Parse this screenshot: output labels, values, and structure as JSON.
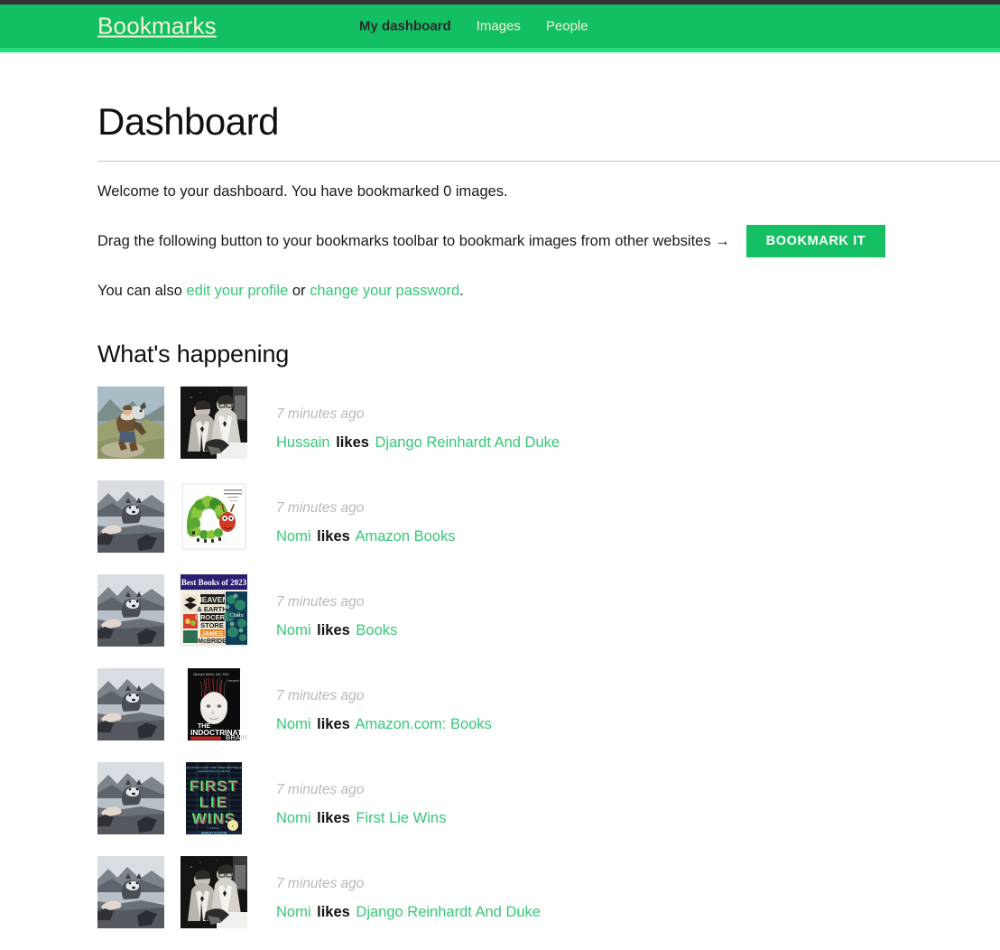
{
  "header": {
    "brand": "Bookmarks",
    "nav": [
      {
        "label": "My dashboard",
        "active": true
      },
      {
        "label": "Images",
        "active": false
      },
      {
        "label": "People",
        "active": false
      }
    ],
    "colors": {
      "top_bar": "#333333",
      "band": "#12bf63",
      "underline": "#27de7d",
      "brand_text": "#f5f0d8",
      "active_nav_text": "#2a2a2a"
    }
  },
  "main": {
    "page_title": "Dashboard",
    "welcome_text": "Welcome to your dashboard. You have bookmarked 0 images.",
    "bookmarked_count": 0,
    "bookmarklet_text": "Drag the following button to your bookmarks toolbar to bookmark images from other websites →",
    "bookmarklet_button_label": "BOOKMARK IT",
    "bookmarklet_button_color": "#15c065",
    "profile_line": {
      "prefix": "You can also ",
      "edit_profile_label": "edit your profile",
      "separator": " or ",
      "change_password_label": "change your password",
      "suffix": "."
    },
    "link_color": "#36c877"
  },
  "happening": {
    "title": "What's happening",
    "items": [
      {
        "time": "7 minutes ago",
        "user": "Hussain",
        "verb": "likes",
        "target": "Django Reinhardt And Duke",
        "thumb_left": "man-with-husky-photo",
        "thumb_right": "django-duke-bw-photo"
      },
      {
        "time": "7 minutes ago",
        "user": "Nomi",
        "verb": "likes",
        "target": "Amazon Books",
        "thumb_left": "wolf-mountain-photo",
        "thumb_right": "very-hungry-caterpillar-cover"
      },
      {
        "time": "7 minutes ago",
        "user": "Nomi",
        "verb": "likes",
        "target": "Books",
        "thumb_left": "wolf-mountain-photo",
        "thumb_right": "best-books-of-2023-cover"
      },
      {
        "time": "7 minutes ago",
        "user": "Nomi",
        "verb": "likes",
        "target": "Amazon.com: Books",
        "thumb_left": "wolf-mountain-photo",
        "thumb_right": "indoctrinated-brain-cover"
      },
      {
        "time": "7 minutes ago",
        "user": "Nomi",
        "verb": "likes",
        "target": "First Lie Wins",
        "thumb_left": "wolf-mountain-photo",
        "thumb_right": "first-lie-wins-cover"
      },
      {
        "time": "7 minutes ago",
        "user": "Nomi",
        "verb": "likes",
        "target": "Django Reinhardt And Duke",
        "thumb_left": "wolf-mountain-photo",
        "thumb_right": "django-duke-bw-photo"
      }
    ]
  }
}
